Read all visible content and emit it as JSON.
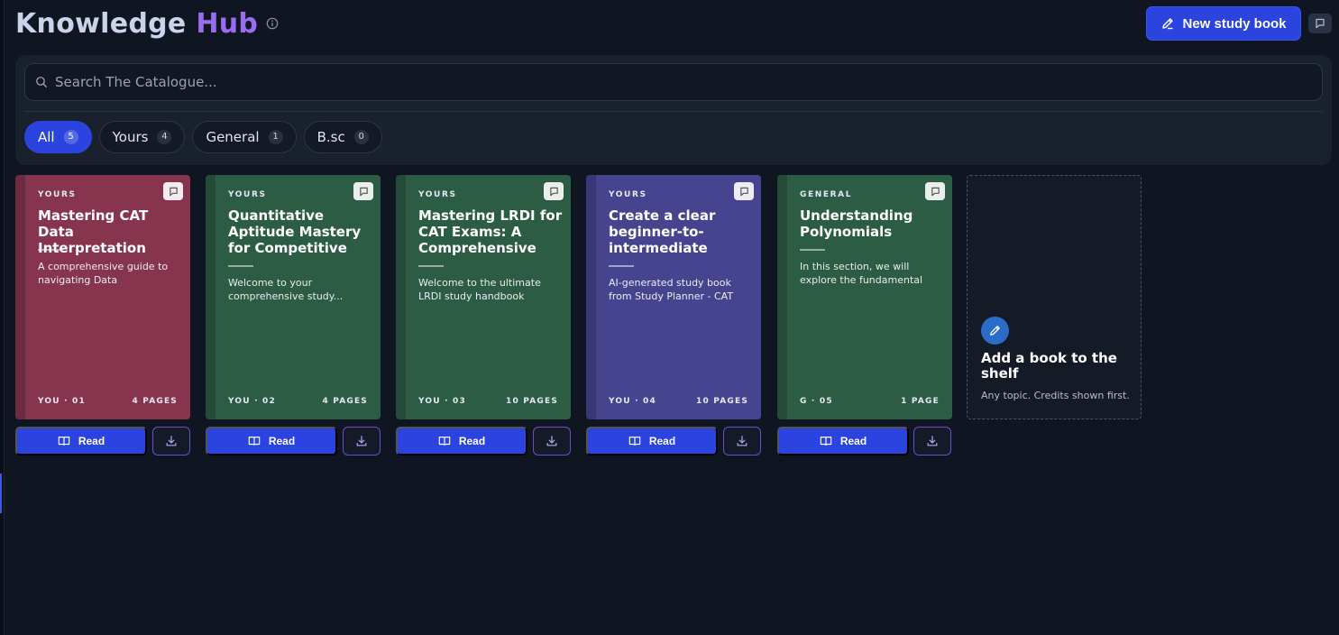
{
  "header": {
    "title_part1": "Knowledge",
    "title_part2": "Hub",
    "new_book_label": "New study book"
  },
  "search": {
    "placeholder": "Search The Catalogue...",
    "value": ""
  },
  "filters": [
    {
      "label": "All",
      "count": "5",
      "active": true
    },
    {
      "label": "Yours",
      "count": "4",
      "active": false
    },
    {
      "label": "General",
      "count": "1",
      "active": false
    },
    {
      "label": "B.sc",
      "count": "0",
      "active": false
    }
  ],
  "books": [
    {
      "tag": "YOURS",
      "title": "Mastering CAT Data Interpretation",
      "description": "A comprehensive guide to navigating Data Interpretatio...",
      "owner": "YOU · 01",
      "pages": "4 PAGES",
      "color": "#87344f"
    },
    {
      "tag": "YOURS",
      "title": "Quantitative Aptitude Mastery for Competitive Exams",
      "description": "Welcome to your comprehensive study...",
      "owner": "YOU · 02",
      "pages": "4 PAGES",
      "color": "#2d5c44"
    },
    {
      "tag": "YOURS",
      "title": "Mastering LRDI for CAT Exams: A Comprehensive",
      "description": "Welcome to the ultimate LRDI study handbook tailored...",
      "owner": "YOU · 03",
      "pages": "10 PAGES",
      "color": "#2d5c44"
    },
    {
      "tag": "YOURS",
      "title": "Create a clear beginner-to-intermediate study",
      "description": "AI-generated study book from Study Planner - CAT VARC prep",
      "owner": "YOU · 04",
      "pages": "10 PAGES",
      "color": "#46448f"
    },
    {
      "tag": "GENERAL",
      "title": "Understanding Polynomials",
      "description": "In this section, we will explore the fundamental concepts of...",
      "owner": "G · 05",
      "pages": "1 PAGE",
      "color": "#2d5c44"
    }
  ],
  "actions": {
    "read_label": "Read"
  },
  "add_card": {
    "title": "Add a book to the shelf",
    "subtitle": "Any topic. Credits shown first."
  },
  "colors": {
    "accent": "#2b44e0",
    "brand_purple": "#9a6cf0"
  }
}
